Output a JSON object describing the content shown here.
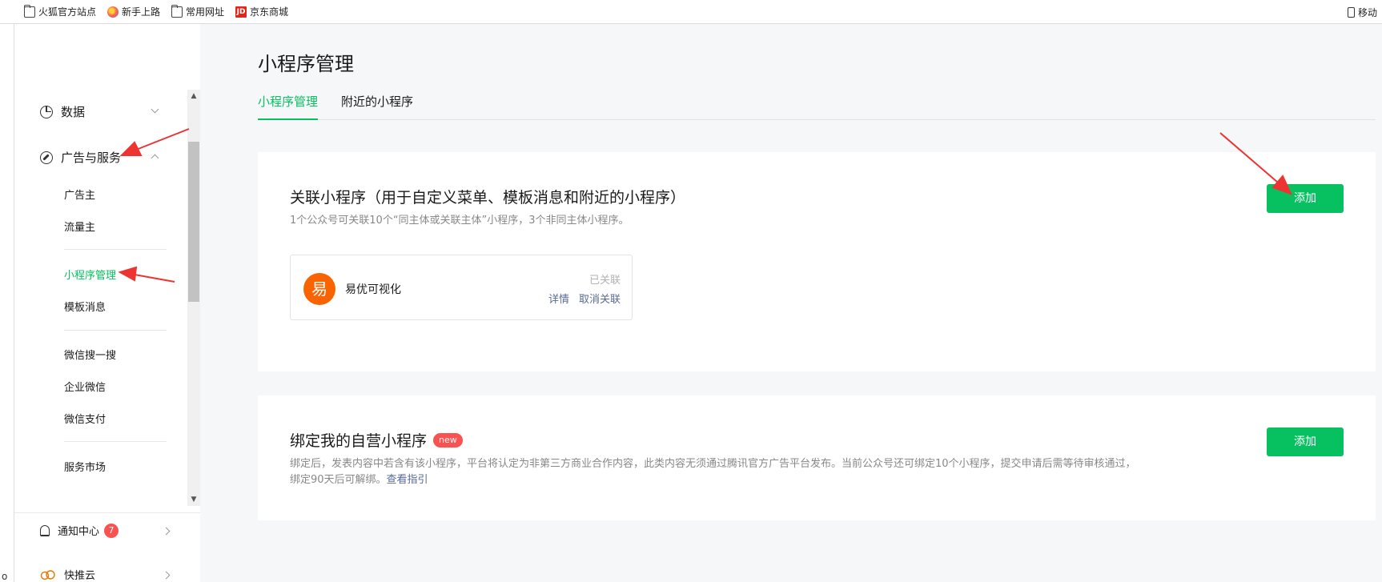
{
  "bookmarks": [
    {
      "label": "火狐官方站点",
      "icon": "folder-icon"
    },
    {
      "label": "新手上路",
      "icon": "firefox-icon"
    },
    {
      "label": "常用网址",
      "icon": "folder-icon"
    },
    {
      "label": "京东商城",
      "icon": "jd-icon"
    }
  ],
  "bookmarks_right": {
    "label": "移动",
    "icon": "mobile-icon"
  },
  "gutter_glyph": "o",
  "sidebar": {
    "data_label": "数据",
    "ads_label": "广告与服务",
    "sub_items": {
      "advertiser": "广告主",
      "publisher": "流量主",
      "mini_program": "小程序管理",
      "template": "模板消息",
      "search": "微信搜一搜",
      "work_wechat": "企业微信",
      "pay": "微信支付",
      "market": "服务市场"
    },
    "notice_label": "通知中心",
    "notice_count": "7",
    "kuaituiyun_label": "快推云"
  },
  "main": {
    "title": "小程序管理",
    "tabs": [
      "小程序管理",
      "附近的小程序"
    ],
    "card1": {
      "title": "关联小程序（用于自定义菜单、模板消息和附近的小程序）",
      "desc": "1个公众号可关联10个“同主体或关联主体”小程序，3个非同主体小程序。",
      "add_label": "添加",
      "item": {
        "avatar_char": "易",
        "name": "易优可视化",
        "status": "已关联",
        "detail": "详情",
        "unlink": "取消关联"
      }
    },
    "card2": {
      "title": "绑定我的自营小程序",
      "badge": "new",
      "desc": "绑定后，发表内容中若含有该小程序，平台将认定为非第三方商业合作内容，此类内容无须通过腾讯官方广告平台发布。当前公众号还可绑定10个小程序，提交申请后需等待审核通过，",
      "desc2": "绑定90天后可解绑。",
      "guide_link": "查看指引",
      "add_label": "添加"
    }
  },
  "colors": {
    "accent": "#07c160",
    "badge": "#fa5151",
    "link": "#576b95",
    "annotation": "#ee3333"
  }
}
